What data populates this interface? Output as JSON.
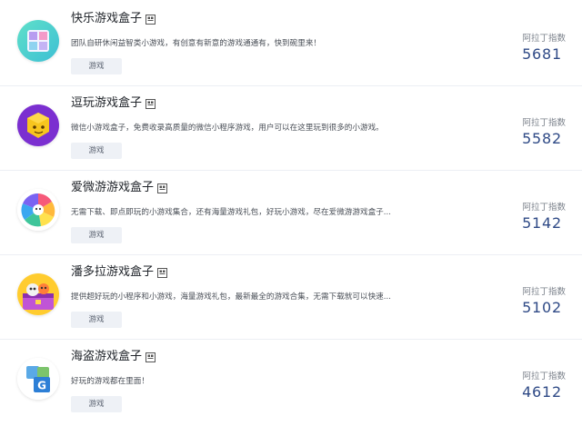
{
  "items": [
    {
      "title": "快乐游戏盒子",
      "description": "团队自研休闲益智类小游戏，有创意有新意的游戏通通有，快到碗里来！",
      "tag": "游戏",
      "index_label": "阿拉丁指数",
      "index_value": "5681",
      "icon": "cube-box-logo-icon"
    },
    {
      "title": "逗玩游戏盒子",
      "description": "微信小游戏盒子，免费收录高质量的微信小程序游戏，用户可以在这里玩到很多的小游戏。",
      "tag": "游戏",
      "index_label": "阿拉丁指数",
      "index_value": "5582",
      "icon": "yellow-cube-logo-icon"
    },
    {
      "title": "爱微游游戏盒子",
      "description": "无需下载、即点即玩的小游戏集合，还有海量游戏礼包，好玩小游戏，尽在爱微游游戏盒子...",
      "tag": "游戏",
      "index_label": "阿拉丁指数",
      "index_value": "5142",
      "icon": "pinwheel-logo-icon"
    },
    {
      "title": "潘多拉游戏盒子",
      "description": "提供超好玩的小程序和小游戏，海量游戏礼包，最新最全的游戏合集，无需下载就可以快速...",
      "tag": "游戏",
      "index_label": "阿拉丁指数",
      "index_value": "5102",
      "icon": "treasure-chest-logo-icon"
    },
    {
      "title": "海盗游戏盒子",
      "description": "好玩的游戏都在里面！",
      "tag": "游戏",
      "index_label": "阿拉丁指数",
      "index_value": "4612",
      "icon": "letter-blocks-logo-icon"
    }
  ],
  "colors": {
    "index_value": "#2f4a86",
    "tag_bg": "#eef1f6",
    "divider": "#eceff4"
  }
}
